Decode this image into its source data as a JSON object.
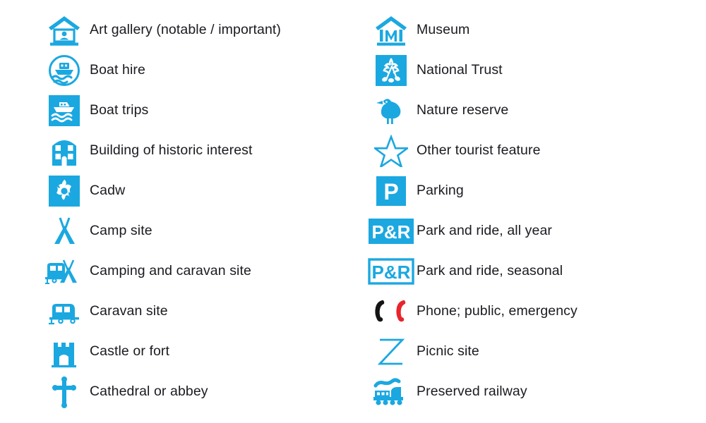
{
  "colors": {
    "symbol_blue": "#1BA8E0",
    "text": "#1a1a20",
    "background": "#ffffff",
    "phone_public": "#141414",
    "phone_emergency": "#E8252A",
    "symbol_white": "#ffffff"
  },
  "legend": {
    "columns": [
      {
        "name": "left-column",
        "items": [
          {
            "icon": "art-gallery-icon",
            "label": "Art gallery (notable / important)"
          },
          {
            "icon": "boat-hire-icon",
            "label": "Boat hire"
          },
          {
            "icon": "boat-trips-icon",
            "label": "Boat trips"
          },
          {
            "icon": "building-historic-icon",
            "label": "Building of historic interest"
          },
          {
            "icon": "cadw-icon",
            "label": "Cadw"
          },
          {
            "icon": "camp-site-icon",
            "label": "Camp site"
          },
          {
            "icon": "camping-caravan-site-icon",
            "label": "Camping and caravan site"
          },
          {
            "icon": "caravan-site-icon",
            "label": "Caravan site"
          },
          {
            "icon": "castle-fort-icon",
            "label": "Castle or fort"
          },
          {
            "icon": "cathedral-abbey-icon",
            "label": "Cathedral or abbey"
          }
        ]
      },
      {
        "name": "right-column",
        "items": [
          {
            "icon": "museum-icon",
            "label": "Museum"
          },
          {
            "icon": "national-trust-icon",
            "label": "National Trust"
          },
          {
            "icon": "nature-reserve-icon",
            "label": "Nature reserve"
          },
          {
            "icon": "other-tourist-feature-icon",
            "label": "Other tourist feature"
          },
          {
            "icon": "parking-icon",
            "label": "Parking",
            "symbol_text": "P"
          },
          {
            "icon": "park-and-ride-all-year-icon",
            "label": "Park and ride, all year",
            "symbol_text": "P&R"
          },
          {
            "icon": "park-and-ride-seasonal-icon",
            "label": "Park and ride, seasonal",
            "symbol_text": "P&R"
          },
          {
            "icon": "phone-icon",
            "label": "Phone; public, emergency"
          },
          {
            "icon": "picnic-site-icon",
            "label": "Picnic site"
          },
          {
            "icon": "preserved-railway-icon",
            "label": "Preserved railway"
          }
        ]
      }
    ]
  }
}
